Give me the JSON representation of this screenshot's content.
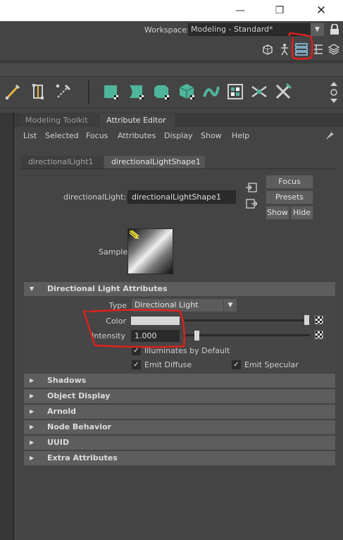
{
  "window": {
    "minimize_icon": "minimize-icon",
    "maximize_icon": "restore-icon",
    "close_icon": "close-icon"
  },
  "workspace": {
    "label": "Workspace:",
    "value": "Modeling - Standard*"
  },
  "panel_tabs": [
    {
      "label": "Modeling Toolkit"
    },
    {
      "label": "Attribute Editor"
    }
  ],
  "menu": [
    "List",
    "Selected",
    "Focus",
    "Attributes",
    "Display",
    "Show",
    "Help"
  ],
  "node_tabs": [
    "directionalLight1",
    "directionalLightShape1"
  ],
  "node": {
    "label": "directionalLight:",
    "value": "directionalLightShape1"
  },
  "buttons": {
    "focus": "Focus",
    "presets": "Presets",
    "show": "Show",
    "hide": "Hide"
  },
  "sample": {
    "label": "Sample"
  },
  "sections": {
    "directional": "Directional Light Attributes",
    "shadows": "Shadows",
    "object_display": "Object Display",
    "arnold": "Arnold",
    "node_behavior": "Node Behavior",
    "uuid": "UUID",
    "extra": "Extra Attributes"
  },
  "attributes": {
    "type_label": "Type",
    "type_value": "Directional Light",
    "color_label": "Color",
    "color_value": "#d7d7d7",
    "intensity_label": "Intensity",
    "intensity_value": "1.000",
    "illuminates_label": "Illuminates by Default",
    "emit_diffuse_label": "Emit Diffuse",
    "emit_specular_label": "Emit Specular"
  },
  "colors": {
    "background": "#444444",
    "annotation": "#e0201c",
    "section_header": "#5d5d5d",
    "shelf_icon": "#4fb59b"
  }
}
